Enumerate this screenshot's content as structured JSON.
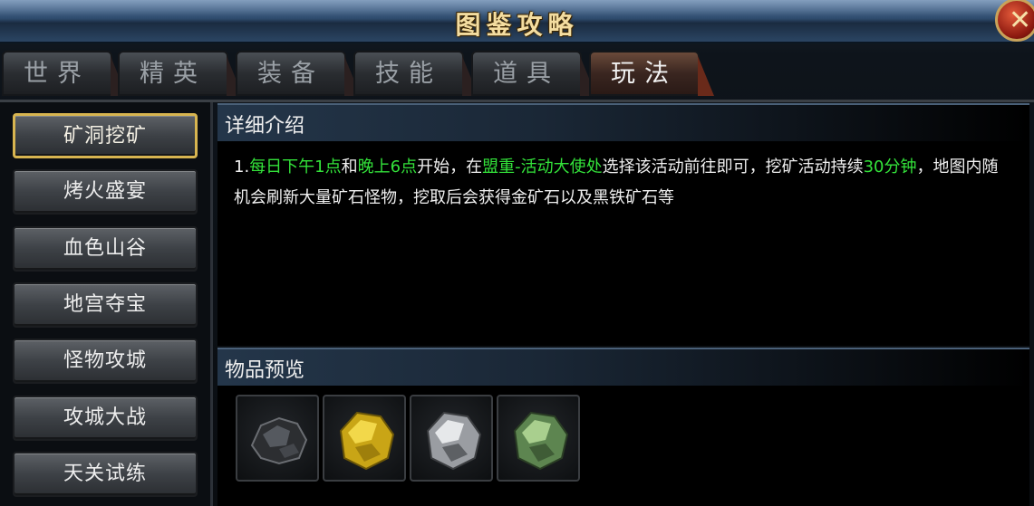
{
  "window": {
    "title": "图鉴攻略"
  },
  "tabs": [
    {
      "label": "世界"
    },
    {
      "label": "精英"
    },
    {
      "label": "装备"
    },
    {
      "label": "技能"
    },
    {
      "label": "道具"
    },
    {
      "label": "玩法",
      "active": true
    }
  ],
  "sidebar": {
    "items": [
      {
        "label": "矿洞挖矿",
        "active": true
      },
      {
        "label": "烤火盛宴"
      },
      {
        "label": "血色山谷"
      },
      {
        "label": "地宫夺宝"
      },
      {
        "label": "怪物攻城"
      },
      {
        "label": "攻城大战"
      },
      {
        "label": "天关试练"
      }
    ]
  },
  "detail": {
    "heading": "详细介绍",
    "segments": [
      {
        "text": "1.",
        "hl": false
      },
      {
        "text": "每日下午1点",
        "hl": true
      },
      {
        "text": "和",
        "hl": false
      },
      {
        "text": "晚上6点",
        "hl": true
      },
      {
        "text": "开始，在",
        "hl": false
      },
      {
        "text": "盟重-活动大使处",
        "hl": true
      },
      {
        "text": "选择该活动前往即可，挖矿活动持续",
        "hl": false
      },
      {
        "text": "30分钟",
        "hl": true
      },
      {
        "text": "，地图内随机会刷新大量矿石怪物，挖取后会获得金矿石以及黑铁矿石等",
        "hl": false
      }
    ]
  },
  "preview": {
    "heading": "物品预览",
    "items": [
      {
        "icon": "black-iron-ore-icon",
        "color": "#3a3c40"
      },
      {
        "icon": "gold-ore-icon",
        "color": "#d4b21e"
      },
      {
        "icon": "silver-ore-icon",
        "color": "#b9bcc0"
      },
      {
        "icon": "jade-ore-icon",
        "color": "#6e9a5a"
      }
    ]
  },
  "colors": {
    "highlight": "#33e23a",
    "active_border": "#d8b550"
  }
}
